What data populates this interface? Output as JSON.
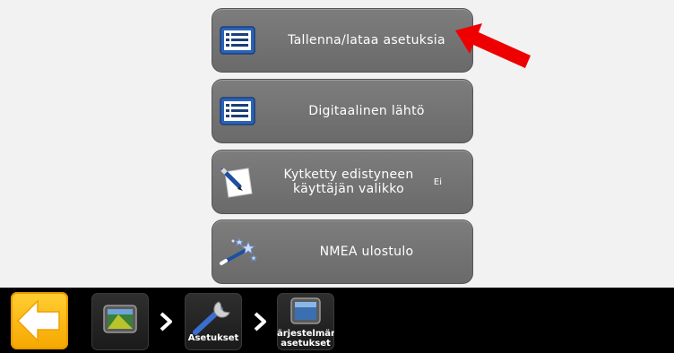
{
  "menu": {
    "items": [
      {
        "label": "Tallenna/lataa asetuksia",
        "icon": "list-icon"
      },
      {
        "label": "Digitaalinen lähtö",
        "icon": "list-icon"
      },
      {
        "label": "Kytketty edistyneen käyttäjän valikko",
        "value": "Ei",
        "icon": "notepad-pen-icon"
      },
      {
        "label": "NMEA ulostulo",
        "icon": "magic-wand-icon"
      }
    ]
  },
  "breadcrumbs": {
    "items": [
      {
        "label": "",
        "icon": "display-terminal-icon"
      },
      {
        "label": "Asetukset",
        "icon": "wrench-icon"
      },
      {
        "label": "ärjestelmän asetukset",
        "label_line1": "ärjestelmän",
        "label_line2": "asetukset",
        "icon": "display-terminal-icon"
      }
    ]
  },
  "colors": {
    "button_bg": "#747474",
    "back_button": "#f9b700",
    "bottom_bar": "#000000",
    "arrow": "#ee0000"
  }
}
